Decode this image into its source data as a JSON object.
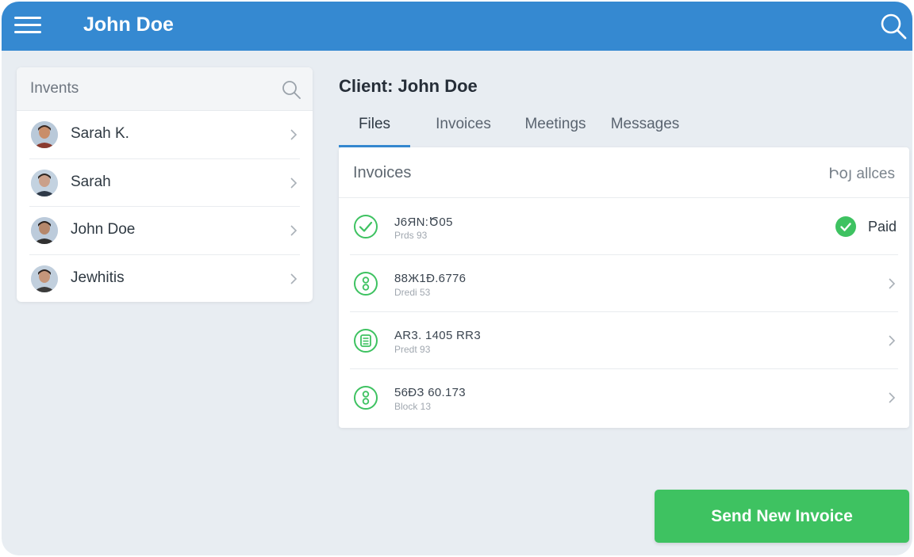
{
  "header": {
    "title": "John Doe",
    "menu_icon": "hamburger-menu-icon",
    "search_icon": "search-icon",
    "color": "#3589d1"
  },
  "clients": {
    "search_placeholder": "Invents",
    "items": [
      {
        "name": "Sarah K."
      },
      {
        "name": "Sarah"
      },
      {
        "name": "John Doe"
      },
      {
        "name": "Jewhitis"
      }
    ]
  },
  "main": {
    "heading": "Client: John Doe",
    "tabs": [
      {
        "label": "Files",
        "active": true
      },
      {
        "label": "Invoices",
        "active": false
      },
      {
        "label": "Meetings",
        "active": false
      },
      {
        "label": "Messages",
        "active": false
      }
    ],
    "invoice_card": {
      "title": "Invoices",
      "meta": "Իօյ allces",
      "rows": [
        {
          "number": "J6ЯN:Ծ05",
          "sub": "Prds 93",
          "icon": "check-circle-icon",
          "status": "Paid"
        },
        {
          "number": "88Ж1Ð.6776",
          "sub": "Dredi 53",
          "icon": "invoice-circle-icon",
          "status": ""
        },
        {
          "number": "AR3. 1405 RR3",
          "sub": "Predt 93",
          "icon": "document-list-icon",
          "status": ""
        },
        {
          "number": "56ÐЗ 60.173",
          "sub": "Block 13",
          "icon": "invoice-circle-icon",
          "status": ""
        }
      ]
    },
    "send_button_label": "Send New Invoice"
  },
  "colors": {
    "accent": "#3589d1",
    "success": "#3ec261",
    "background": "#e8edf2"
  }
}
